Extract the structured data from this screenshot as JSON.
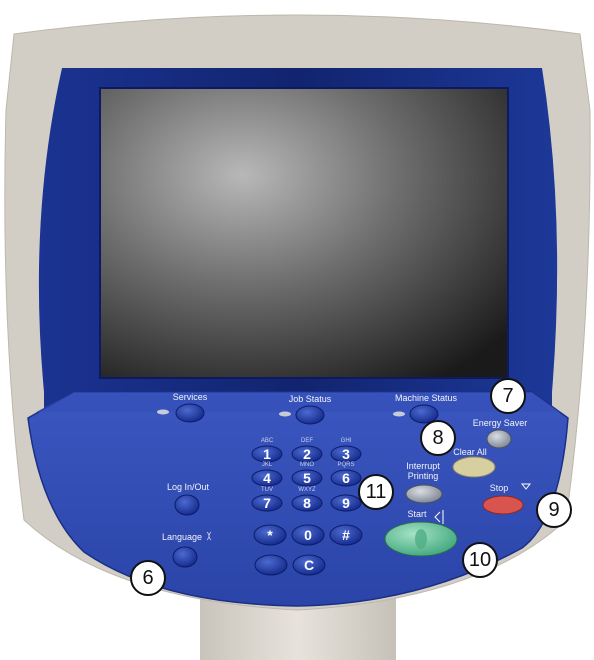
{
  "panel": {
    "services_label": "Services",
    "job_status_label": "Job Status",
    "machine_status_label": "Machine Status",
    "energy_saver_label": "Energy Saver",
    "clear_all_label": "Clear All",
    "interrupt_label_line1": "Interrupt",
    "interrupt_label_line2": "Printing",
    "stop_label": "Stop",
    "start_label": "Start",
    "log_in_out_label": "Log In/Out",
    "language_label": "Language"
  },
  "keypad": {
    "keys": [
      {
        "label": "1",
        "letters": "ABC"
      },
      {
        "label": "2",
        "letters": "DEF"
      },
      {
        "label": "3",
        "letters": "GHI"
      },
      {
        "label": "4",
        "letters": "JKL"
      },
      {
        "label": "5",
        "letters": "MNO"
      },
      {
        "label": "6",
        "letters": "PQRS"
      },
      {
        "label": "7",
        "letters": "TUV"
      },
      {
        "label": "8",
        "letters": "WXYZ"
      },
      {
        "label": "9",
        "letters": ""
      },
      {
        "label": "*",
        "letters": ""
      },
      {
        "label": "0",
        "letters": ""
      },
      {
        "label": "#",
        "letters": ""
      },
      {
        "label": "",
        "letters": ""
      },
      {
        "label": "C",
        "letters": ""
      }
    ]
  },
  "callouts": {
    "c6": "6",
    "c7": "7",
    "c8": "8",
    "c9": "9",
    "c10": "10",
    "c11": "11"
  },
  "colors": {
    "bezel": "#d2cdc4",
    "frame_blue": "#1f3aa0",
    "panel_blue": "#2c48b0",
    "button_blue": "#1d3a9e",
    "clear_all": "#d7cf9f",
    "stop": "#d9534f",
    "start": "#6cc39a",
    "energy_saver": "#9aa2ae"
  }
}
